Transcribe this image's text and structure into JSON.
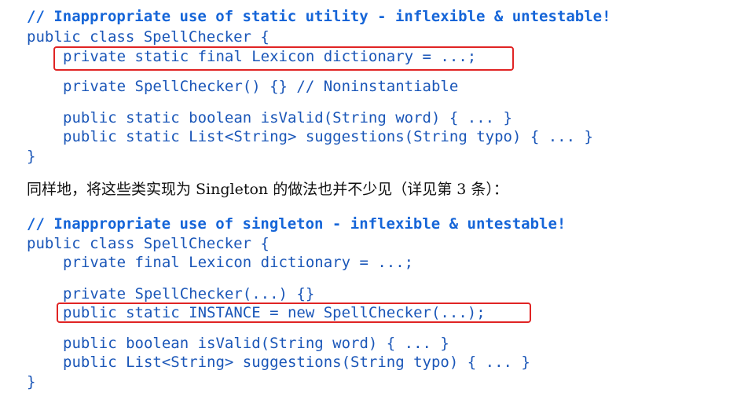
{
  "block1": {
    "comment": "// Inappropriate use of static utility - inflexible & untestable!",
    "class_decl": "public class SpellChecker {",
    "field": "private static final Lexicon dictionary = ...;",
    "ctor": "private SpellChecker() {} // Noninstantiable",
    "method1": "public static boolean isValid(String word) { ... }",
    "method2": "public static List<String> suggestions(String typo) { ... }",
    "close": "}"
  },
  "paragraph": "同样地，将这些类实现为 Singleton 的做法也并不少见（详见第 3 条）：",
  "block2": {
    "comment": "// Inappropriate use of singleton - inflexible & untestable!",
    "class_decl": "public class SpellChecker {",
    "field": "private final Lexicon dictionary = ...;",
    "ctor": "private SpellChecker(...) {}",
    "instance": "public static INSTANCE = new SpellChecker(...);",
    "method1": "public boolean isValid(String word) { ... }",
    "method2": "public List<String> suggestions(String typo) { ... }",
    "close": "}"
  },
  "colors": {
    "code": "#1a56b8",
    "comment": "#1565d8",
    "highlight_box": "#e02424",
    "prose": "#111111"
  }
}
